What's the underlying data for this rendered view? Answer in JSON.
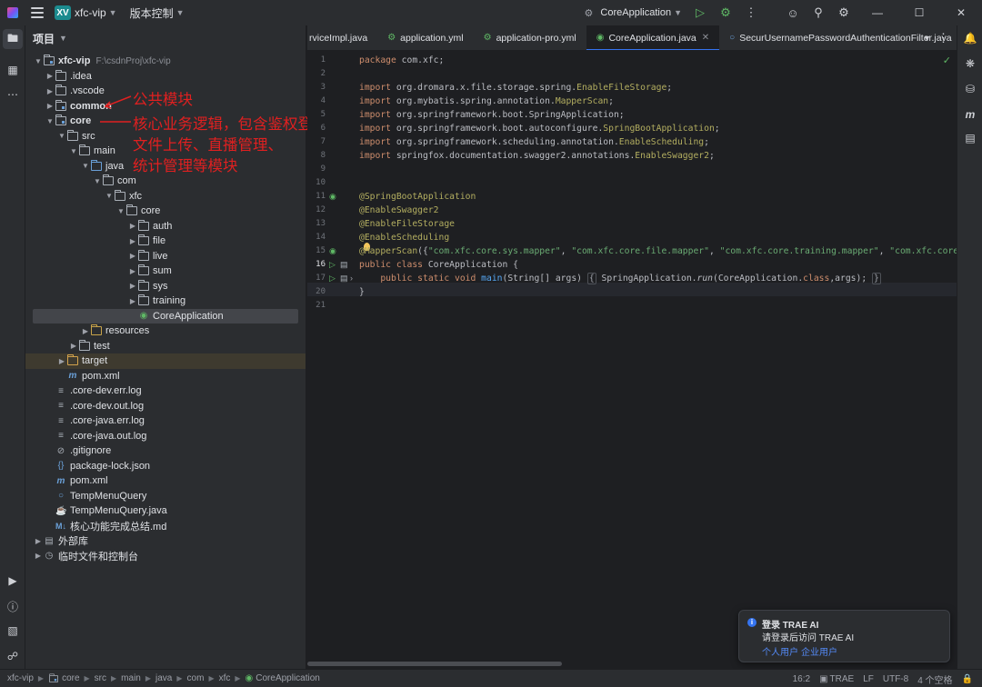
{
  "titlebar": {
    "project_badge": "XV",
    "project_name": "xfc-vip",
    "vcs": "版本控制",
    "run_config": "CoreApplication"
  },
  "project_panel": {
    "header": "项目",
    "tree": [
      {
        "label": "xfc-vip",
        "hint": "F:\\csdnProj\\xfc-vip",
        "indent": 0,
        "arrow": "open",
        "icon": "folder-module",
        "bold": true
      },
      {
        "label": ".idea",
        "indent": 1,
        "arrow": "closed",
        "icon": "folder"
      },
      {
        "label": ".vscode",
        "indent": 1,
        "arrow": "closed",
        "icon": "folder"
      },
      {
        "label": "common",
        "indent": 1,
        "arrow": "closed",
        "icon": "folder-module",
        "bold": true
      },
      {
        "label": "core",
        "indent": 1,
        "arrow": "open",
        "icon": "folder-module",
        "bold": true
      },
      {
        "label": "src",
        "indent": 2,
        "arrow": "open",
        "icon": "folder"
      },
      {
        "label": "main",
        "indent": 3,
        "arrow": "open",
        "icon": "folder"
      },
      {
        "label": "java",
        "indent": 4,
        "arrow": "open",
        "icon": "folder-src"
      },
      {
        "label": "com",
        "indent": 5,
        "arrow": "open",
        "icon": "folder"
      },
      {
        "label": "xfc",
        "indent": 6,
        "arrow": "open",
        "icon": "folder"
      },
      {
        "label": "core",
        "indent": 7,
        "arrow": "open",
        "icon": "folder"
      },
      {
        "label": "auth",
        "indent": 8,
        "arrow": "closed",
        "icon": "folder"
      },
      {
        "label": "file",
        "indent": 8,
        "arrow": "closed",
        "icon": "folder"
      },
      {
        "label": "live",
        "indent": 8,
        "arrow": "closed",
        "icon": "folder"
      },
      {
        "label": "sum",
        "indent": 8,
        "arrow": "closed",
        "icon": "folder"
      },
      {
        "label": "sys",
        "indent": 8,
        "arrow": "closed",
        "icon": "folder"
      },
      {
        "label": "training",
        "indent": 8,
        "arrow": "closed",
        "icon": "folder"
      },
      {
        "label": "CoreApplication",
        "indent": 8,
        "arrow": "none",
        "icon": "spring-class",
        "selected": true
      },
      {
        "label": "resources",
        "indent": 4,
        "arrow": "closed",
        "icon": "folder-res"
      },
      {
        "label": "test",
        "indent": 3,
        "arrow": "closed",
        "icon": "folder"
      },
      {
        "label": "target",
        "indent": 2,
        "arrow": "closed",
        "icon": "folder-target",
        "target": true
      },
      {
        "label": "pom.xml",
        "indent": 2,
        "arrow": "none",
        "icon": "maven"
      },
      {
        "label": ".core-dev.err.log",
        "indent": 1,
        "arrow": "none",
        "icon": "text"
      },
      {
        "label": ".core-dev.out.log",
        "indent": 1,
        "arrow": "none",
        "icon": "text"
      },
      {
        "label": ".core-java.err.log",
        "indent": 1,
        "arrow": "none",
        "icon": "text"
      },
      {
        "label": ".core-java.out.log",
        "indent": 1,
        "arrow": "none",
        "icon": "text"
      },
      {
        "label": ".gitignore",
        "indent": 1,
        "arrow": "none",
        "icon": "ignore"
      },
      {
        "label": "package-lock.json",
        "indent": 1,
        "arrow": "none",
        "icon": "json"
      },
      {
        "label": "pom.xml",
        "indent": 1,
        "arrow": "none",
        "icon": "maven"
      },
      {
        "label": "TempMenuQuery",
        "indent": 1,
        "arrow": "none",
        "icon": "class"
      },
      {
        "label": "TempMenuQuery.java",
        "indent": 1,
        "arrow": "none",
        "icon": "java"
      },
      {
        "label": "核心功能完成总结.md",
        "indent": 1,
        "arrow": "none",
        "icon": "markdown"
      },
      {
        "label": "外部库",
        "indent": 0,
        "arrow": "closed",
        "icon": "library"
      },
      {
        "label": "临时文件和控制台",
        "indent": 0,
        "arrow": "closed",
        "icon": "scratch"
      }
    ]
  },
  "annotations": {
    "common": "公共模块",
    "core_line1": "核心业务逻辑，包含鉴权登录、",
    "core_line2": "文件上传、直播管理、",
    "core_line3": "统计管理等模块"
  },
  "tabs": [
    {
      "label": "rviceImpl.java",
      "icon": "java"
    },
    {
      "label": "application.yml",
      "icon": "yaml"
    },
    {
      "label": "application-pro.yml",
      "icon": "yaml"
    },
    {
      "label": "CoreApplication.java",
      "icon": "spring-class",
      "active": true
    },
    {
      "label": "SecurUsernamePasswordAuthenticationFilter.java",
      "icon": "class"
    }
  ],
  "code": {
    "line_numbers": [
      "1",
      "2",
      "3",
      "4",
      "5",
      "6",
      "7",
      "8",
      "9",
      "10",
      "11",
      "12",
      "13",
      "14",
      "15",
      "16",
      "17",
      "20",
      "21"
    ],
    "current_line": "16"
  },
  "notification": {
    "title": "登录 TRAE AI",
    "body": "请登录后访问 TRAE AI",
    "link_personal": "个人用户",
    "link_enterprise": "企业用户"
  },
  "statusbar": {
    "breadcrumbs": [
      "xfc-vip",
      "core",
      "src",
      "main",
      "java",
      "com",
      "xfc",
      "CoreApplication"
    ],
    "position": "16:2",
    "plugin": "TRAE",
    "line_sep": "LF",
    "encoding": "UTF-8",
    "indent": "4 个空格"
  },
  "colors": {
    "accent": "#3574f0",
    "annotation_red": "#e02020",
    "run_green": "#5fb865"
  }
}
